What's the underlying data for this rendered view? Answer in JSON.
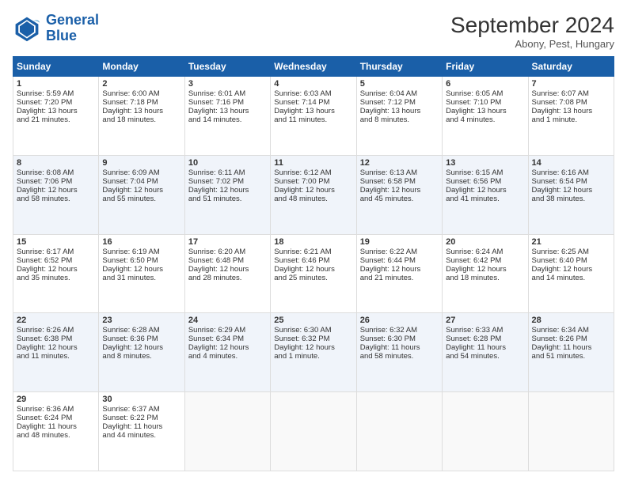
{
  "logo": {
    "line1": "General",
    "line2": "Blue"
  },
  "header": {
    "month_year": "September 2024",
    "location": "Abony, Pest, Hungary"
  },
  "weekdays": [
    "Sunday",
    "Monday",
    "Tuesday",
    "Wednesday",
    "Thursday",
    "Friday",
    "Saturday"
  ],
  "weeks": [
    [
      {
        "day": "1",
        "lines": [
          "Sunrise: 5:59 AM",
          "Sunset: 7:20 PM",
          "Daylight: 13 hours",
          "and 21 minutes."
        ]
      },
      {
        "day": "2",
        "lines": [
          "Sunrise: 6:00 AM",
          "Sunset: 7:18 PM",
          "Daylight: 13 hours",
          "and 18 minutes."
        ]
      },
      {
        "day": "3",
        "lines": [
          "Sunrise: 6:01 AM",
          "Sunset: 7:16 PM",
          "Daylight: 13 hours",
          "and 14 minutes."
        ]
      },
      {
        "day": "4",
        "lines": [
          "Sunrise: 6:03 AM",
          "Sunset: 7:14 PM",
          "Daylight: 13 hours",
          "and 11 minutes."
        ]
      },
      {
        "day": "5",
        "lines": [
          "Sunrise: 6:04 AM",
          "Sunset: 7:12 PM",
          "Daylight: 13 hours",
          "and 8 minutes."
        ]
      },
      {
        "day": "6",
        "lines": [
          "Sunrise: 6:05 AM",
          "Sunset: 7:10 PM",
          "Daylight: 13 hours",
          "and 4 minutes."
        ]
      },
      {
        "day": "7",
        "lines": [
          "Sunrise: 6:07 AM",
          "Sunset: 7:08 PM",
          "Daylight: 13 hours",
          "and 1 minute."
        ]
      }
    ],
    [
      {
        "day": "8",
        "lines": [
          "Sunrise: 6:08 AM",
          "Sunset: 7:06 PM",
          "Daylight: 12 hours",
          "and 58 minutes."
        ]
      },
      {
        "day": "9",
        "lines": [
          "Sunrise: 6:09 AM",
          "Sunset: 7:04 PM",
          "Daylight: 12 hours",
          "and 55 minutes."
        ]
      },
      {
        "day": "10",
        "lines": [
          "Sunrise: 6:11 AM",
          "Sunset: 7:02 PM",
          "Daylight: 12 hours",
          "and 51 minutes."
        ]
      },
      {
        "day": "11",
        "lines": [
          "Sunrise: 6:12 AM",
          "Sunset: 7:00 PM",
          "Daylight: 12 hours",
          "and 48 minutes."
        ]
      },
      {
        "day": "12",
        "lines": [
          "Sunrise: 6:13 AM",
          "Sunset: 6:58 PM",
          "Daylight: 12 hours",
          "and 45 minutes."
        ]
      },
      {
        "day": "13",
        "lines": [
          "Sunrise: 6:15 AM",
          "Sunset: 6:56 PM",
          "Daylight: 12 hours",
          "and 41 minutes."
        ]
      },
      {
        "day": "14",
        "lines": [
          "Sunrise: 6:16 AM",
          "Sunset: 6:54 PM",
          "Daylight: 12 hours",
          "and 38 minutes."
        ]
      }
    ],
    [
      {
        "day": "15",
        "lines": [
          "Sunrise: 6:17 AM",
          "Sunset: 6:52 PM",
          "Daylight: 12 hours",
          "and 35 minutes."
        ]
      },
      {
        "day": "16",
        "lines": [
          "Sunrise: 6:19 AM",
          "Sunset: 6:50 PM",
          "Daylight: 12 hours",
          "and 31 minutes."
        ]
      },
      {
        "day": "17",
        "lines": [
          "Sunrise: 6:20 AM",
          "Sunset: 6:48 PM",
          "Daylight: 12 hours",
          "and 28 minutes."
        ]
      },
      {
        "day": "18",
        "lines": [
          "Sunrise: 6:21 AM",
          "Sunset: 6:46 PM",
          "Daylight: 12 hours",
          "and 25 minutes."
        ]
      },
      {
        "day": "19",
        "lines": [
          "Sunrise: 6:22 AM",
          "Sunset: 6:44 PM",
          "Daylight: 12 hours",
          "and 21 minutes."
        ]
      },
      {
        "day": "20",
        "lines": [
          "Sunrise: 6:24 AM",
          "Sunset: 6:42 PM",
          "Daylight: 12 hours",
          "and 18 minutes."
        ]
      },
      {
        "day": "21",
        "lines": [
          "Sunrise: 6:25 AM",
          "Sunset: 6:40 PM",
          "Daylight: 12 hours",
          "and 14 minutes."
        ]
      }
    ],
    [
      {
        "day": "22",
        "lines": [
          "Sunrise: 6:26 AM",
          "Sunset: 6:38 PM",
          "Daylight: 12 hours",
          "and 11 minutes."
        ]
      },
      {
        "day": "23",
        "lines": [
          "Sunrise: 6:28 AM",
          "Sunset: 6:36 PM",
          "Daylight: 12 hours",
          "and 8 minutes."
        ]
      },
      {
        "day": "24",
        "lines": [
          "Sunrise: 6:29 AM",
          "Sunset: 6:34 PM",
          "Daylight: 12 hours",
          "and 4 minutes."
        ]
      },
      {
        "day": "25",
        "lines": [
          "Sunrise: 6:30 AM",
          "Sunset: 6:32 PM",
          "Daylight: 12 hours",
          "and 1 minute."
        ]
      },
      {
        "day": "26",
        "lines": [
          "Sunrise: 6:32 AM",
          "Sunset: 6:30 PM",
          "Daylight: 11 hours",
          "and 58 minutes."
        ]
      },
      {
        "day": "27",
        "lines": [
          "Sunrise: 6:33 AM",
          "Sunset: 6:28 PM",
          "Daylight: 11 hours",
          "and 54 minutes."
        ]
      },
      {
        "day": "28",
        "lines": [
          "Sunrise: 6:34 AM",
          "Sunset: 6:26 PM",
          "Daylight: 11 hours",
          "and 51 minutes."
        ]
      }
    ],
    [
      {
        "day": "29",
        "lines": [
          "Sunrise: 6:36 AM",
          "Sunset: 6:24 PM",
          "Daylight: 11 hours",
          "and 48 minutes."
        ]
      },
      {
        "day": "30",
        "lines": [
          "Sunrise: 6:37 AM",
          "Sunset: 6:22 PM",
          "Daylight: 11 hours",
          "and 44 minutes."
        ]
      },
      null,
      null,
      null,
      null,
      null
    ]
  ]
}
